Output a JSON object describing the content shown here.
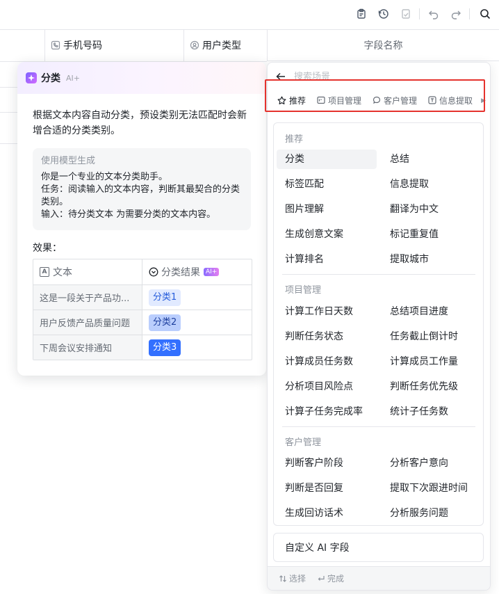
{
  "toolbar": {
    "icons": [
      "clipboard-icon",
      "history-icon",
      "checklist-icon",
      "undo-icon",
      "redo-icon",
      "search-icon"
    ]
  },
  "table": {
    "columns": [
      {
        "label": "手机号码",
        "icon": "phone-field-icon"
      },
      {
        "label": "用户类型",
        "icon": "user-type-field-icon"
      }
    ],
    "field_name_header": "字段名称"
  },
  "card": {
    "title": "分类",
    "ai_label": "AI+",
    "description": "根据文本内容自动分类，预设类别无法匹配时会新增合适的分类类别。",
    "prompt_label": "使用模型生成",
    "prompt_lines": [
      "你是一个专业的文本分类助手。",
      "任务：阅读输入的文本内容，判断其最契合的分类类别。",
      "输入：待分类文本 为需要分类的文本内容。"
    ],
    "effect_label": "效果：",
    "example": {
      "col1_header": "文本",
      "col1_icon_letter": "A",
      "col2_header": "分类结果",
      "col2_badge": "AI+",
      "rows": [
        {
          "text": "这是一段关于产品功...",
          "result": "分类1"
        },
        {
          "text": "用户反馈产品质量问题",
          "result": "分类2"
        },
        {
          "text": "下周会议安排通知",
          "result": "分类3"
        }
      ]
    }
  },
  "panel": {
    "search_placeholder": "搜索场景",
    "tabs": [
      {
        "label": "推荐",
        "icon": "star-icon",
        "active": true
      },
      {
        "label": "项目管理",
        "icon": "project-icon",
        "active": false
      },
      {
        "label": "客户管理",
        "icon": "chat-icon",
        "active": false
      },
      {
        "label": "信息提取",
        "icon": "text-extract-icon",
        "active": false
      }
    ],
    "groups": [
      {
        "title": "推荐",
        "items": [
          "分类",
          "总结",
          "标签匹配",
          "信息提取",
          "图片理解",
          "翻译为中文",
          "生成创意文案",
          "标记重复值",
          "计算排名",
          "提取城市"
        ]
      },
      {
        "title": "项目管理",
        "items": [
          "计算工作日天数",
          "总结项目进度",
          "判断任务状态",
          "任务截止倒计时",
          "计算成员任务数",
          "计算成员工作量",
          "分析项目风险点",
          "判断任务优先级",
          "计算子任务完成率",
          "统计子任务数"
        ]
      },
      {
        "title": "客户管理",
        "items": [
          "判断客户阶段",
          "分析客户意向",
          "判断是否回复",
          "提取下次跟进时间",
          "生成回访话术",
          "分析服务问题"
        ]
      }
    ],
    "selected_item": "分类",
    "custom_field_label": "自定义 AI 字段",
    "footer": {
      "select_hint": "选择",
      "confirm_hint": "完成"
    }
  },
  "colors": {
    "accent": "#3370ff",
    "highlight_box": "#e5322d"
  }
}
